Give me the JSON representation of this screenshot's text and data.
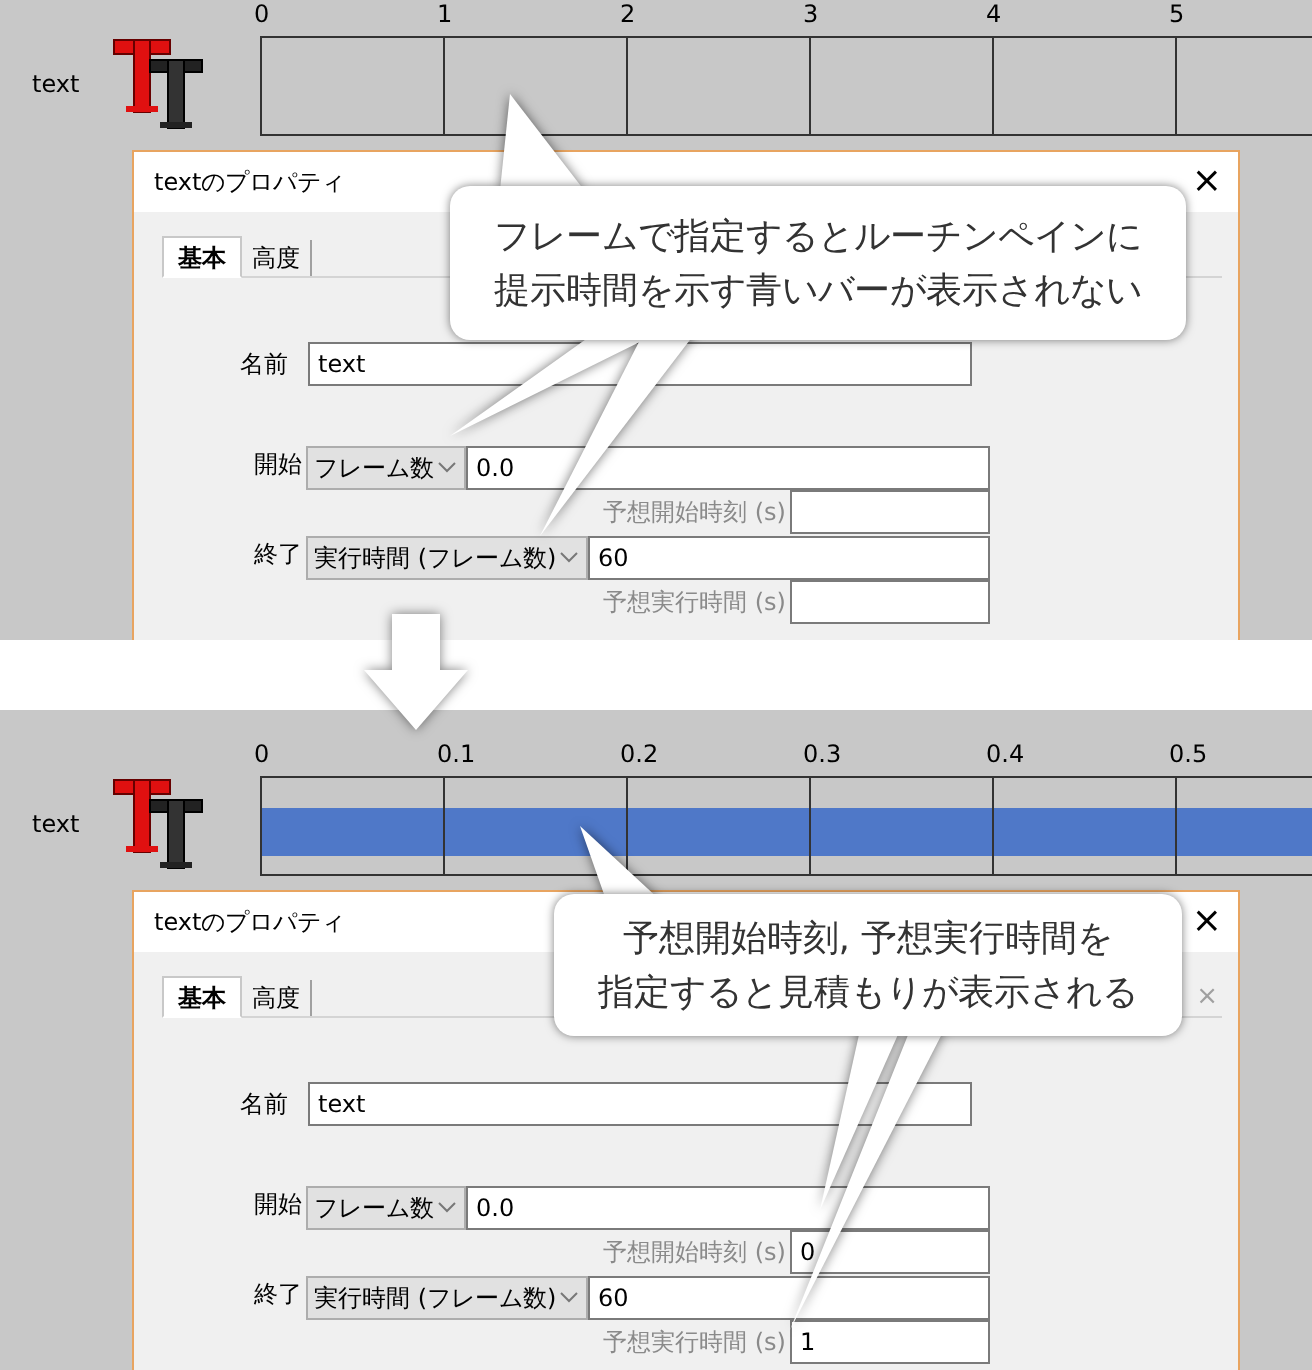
{
  "panels": [
    {
      "timeline": {
        "track_label": "text",
        "ticks": [
          "0",
          "1",
          "2",
          "3",
          "4",
          "5"
        ],
        "bar_visible": false
      },
      "dialog": {
        "title": "textのプロパティ",
        "close": "×",
        "tabs": [
          {
            "label": "基本",
            "selected": true
          },
          {
            "label": "高度",
            "selected": false
          }
        ],
        "name_label": "名前",
        "name_value": "text",
        "start": {
          "label": "開始",
          "mode": "フレーム数",
          "value": "0.0",
          "estimate_label": "予想開始時刻 (s)"
        },
        "end": {
          "label": "終了",
          "mode": "実行時間 (フレーム数)",
          "value": "60",
          "estimate_label": "予想実行時間 (s)"
        }
      },
      "callout": {
        "lines": [
          "フレームで指定するとルーチンペインに",
          "提示時間を示す青いバーが表示されない"
        ]
      }
    },
    {
      "timeline": {
        "track_label": "text",
        "ticks": [
          "0",
          "0.1",
          "0.2",
          "0.3",
          "0.4",
          "0.5"
        ],
        "bar_visible": true
      },
      "dialog": {
        "title": "textのプロパティ",
        "close": "×",
        "tabs": [
          {
            "label": "基本",
            "selected": true
          },
          {
            "label": "高度",
            "selected": false
          }
        ],
        "tab_close": "×",
        "name_label": "名前",
        "name_value": "text",
        "start": {
          "label": "開始",
          "mode": "フレーム数",
          "value": "0.0",
          "estimate_label": "予想開始時刻 (s)",
          "estimate_value": "0"
        },
        "end": {
          "label": "終了",
          "mode": "実行時間 (フレーム数)",
          "value": "60",
          "estimate_label": "予想実行時間 (s)",
          "estimate_value": "1"
        }
      },
      "callout": {
        "lines": [
          "予想開始時刻, 予想実行時間を",
          "指定すると見積もりが表示される"
        ]
      }
    }
  ]
}
